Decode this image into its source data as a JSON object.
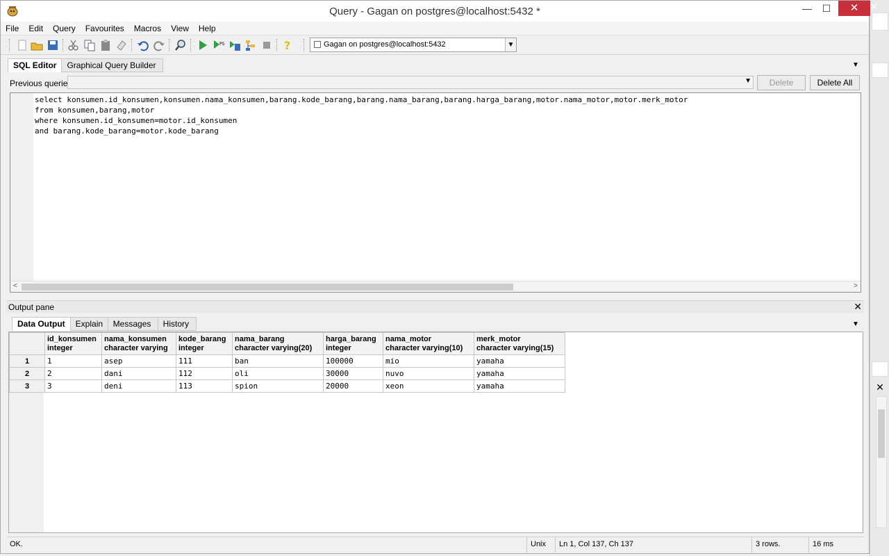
{
  "window": {
    "title": "Query - Gagan on postgres@localhost:5432 *",
    "controls": {
      "minimize": "—",
      "maximize": "☐",
      "close": "✕"
    }
  },
  "menu": [
    "File",
    "Edit",
    "Query",
    "Favourites",
    "Macros",
    "View",
    "Help"
  ],
  "toolbar": {
    "connection": "Gagan on postgres@localhost:5432"
  },
  "editor": {
    "tabs": [
      "SQL Editor",
      "Graphical Query Builder"
    ],
    "previous_queries_label": "Previous queries",
    "delete_label": "Delete",
    "delete_all_label": "Delete All",
    "sql_lines": [
      "select konsumen.id_konsumen,konsumen.nama_konsumen,barang.kode_barang,barang.nama_barang,barang.harga_barang,motor.nama_motor,motor.merk_motor",
      "from konsumen,barang,motor",
      "where konsumen.id_konsumen=motor.id_konsumen",
      "and barang.kode_barang=motor.kode_barang"
    ]
  },
  "output": {
    "title": "Output pane",
    "tabs": [
      "Data Output",
      "Explain",
      "Messages",
      "History"
    ],
    "columns": [
      {
        "name": "id_konsumen",
        "type": "integer"
      },
      {
        "name": "nama_konsumen",
        "type": "character varying"
      },
      {
        "name": "kode_barang",
        "type": "integer"
      },
      {
        "name": "nama_barang",
        "type": "character varying(20)"
      },
      {
        "name": "harga_barang",
        "type": "integer"
      },
      {
        "name": "nama_motor",
        "type": "character varying(10)"
      },
      {
        "name": "merk_motor",
        "type": "character varying(15)"
      }
    ],
    "rows": [
      {
        "n": "1",
        "cells": [
          "1",
          "asep",
          "111",
          "ban",
          "100000",
          "mio",
          "yamaha"
        ]
      },
      {
        "n": "2",
        "cells": [
          "2",
          "dani",
          "112",
          "oli",
          "30000",
          "nuvo",
          "yamaha"
        ]
      },
      {
        "n": "3",
        "cells": [
          "3",
          "deni",
          "113",
          "spion",
          "20000",
          "xeon",
          "yamaha"
        ]
      }
    ]
  },
  "status": {
    "message": "OK.",
    "line_ending": "Unix",
    "cursor": "Ln 1, Col 137, Ch 137",
    "row_count": "3 rows.",
    "time": "16 ms"
  },
  "colors": {
    "close_button": "#c7303a",
    "window_bg": "#f0f0f0"
  }
}
